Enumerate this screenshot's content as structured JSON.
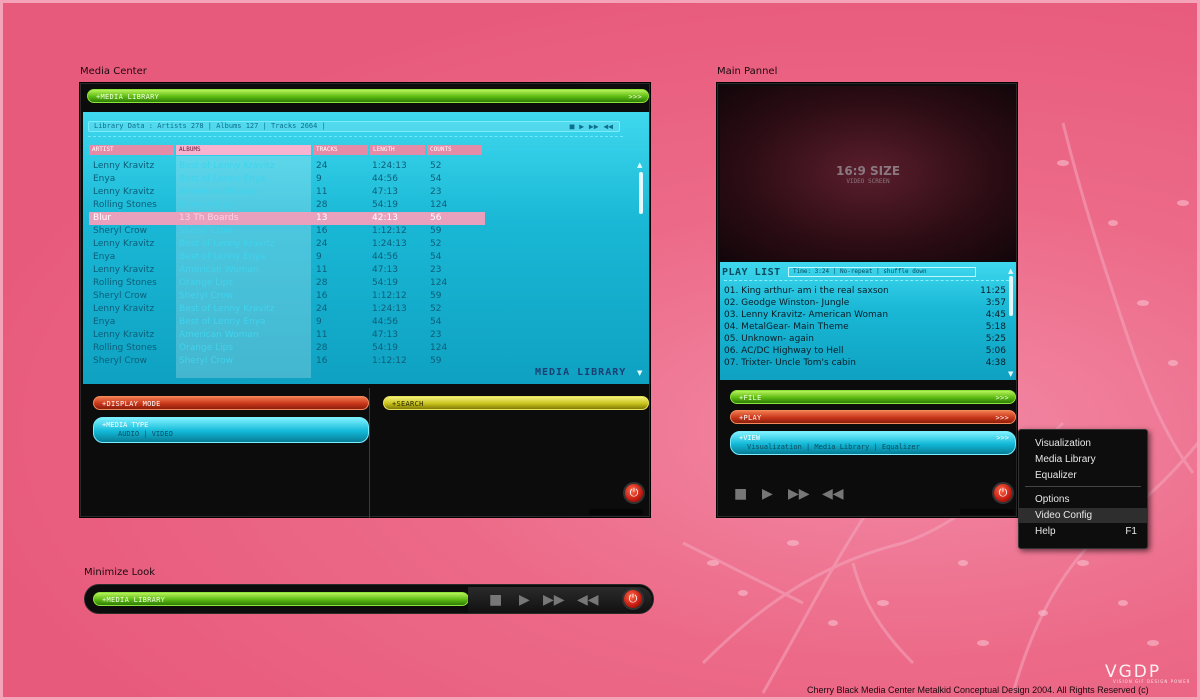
{
  "colors": {
    "background": "#e85a7c",
    "cyan": "#1ab8d6",
    "green": "#5dbb12",
    "red": "#c8361a",
    "yellow": "#c9c21b"
  },
  "media_center": {
    "title": "Media Center",
    "header_pill": "+MEDIA LIBRARY",
    "header_arrows": ">>>",
    "library_data": "Library Data :  Artists 278 | Albums 127 | Tracks 2664 |",
    "columns": [
      "ARTIST",
      "ALBUMS",
      "TRACKS",
      "LENGTH",
      "COUNTS"
    ],
    "rows": [
      [
        "Lenny Kravitz",
        "Best of Lenny Kravitz",
        "24",
        "1:24:13",
        "52"
      ],
      [
        "Enya",
        "Best of Lenny Enya",
        "9",
        "44:56",
        "54"
      ],
      [
        "Lenny Kravitz",
        "American Woman",
        "11",
        "47:13",
        "23"
      ],
      [
        "Rolling Stones",
        "Orange Lips",
        "28",
        "54:19",
        "124"
      ],
      [
        "Blur",
        "13 Th Boards",
        "13",
        "42:13",
        "56"
      ],
      [
        "Sheryl Crow",
        "Sheryl Crow",
        "16",
        "1:12:12",
        "59"
      ],
      [
        "Lenny Kravitz",
        "Best of Lenny Kravitz",
        "24",
        "1:24:13",
        "52"
      ],
      [
        "Enya",
        "Best of Lenny Enya",
        "9",
        "44:56",
        "54"
      ],
      [
        "Lenny Kravitz",
        "American Woman",
        "11",
        "47:13",
        "23"
      ],
      [
        "Rolling Stones",
        "Orange Lips",
        "28",
        "54:19",
        "124"
      ],
      [
        "Sheryl Crow",
        "Sheryl Crow",
        "16",
        "1:12:12",
        "59"
      ],
      [
        "Lenny Kravitz",
        "Best of Lenny Kravitz",
        "24",
        "1:24:13",
        "52"
      ],
      [
        "Enya",
        "Best of Lenny Enya",
        "9",
        "44:56",
        "54"
      ],
      [
        "Lenny Kravitz",
        "American Woman",
        "11",
        "47:13",
        "23"
      ],
      [
        "Rolling Stones",
        "Orange Lips",
        "28",
        "54:19",
        "124"
      ],
      [
        "Sheryl Crow",
        "Sheryl Crow",
        "16",
        "1:12:12",
        "59"
      ]
    ],
    "library_brand": "MEDIA LIBRARY",
    "display_mode": "+DISPLAY MODE",
    "media_type": "+MEDIA TYPE",
    "media_type_options": "AUDIO   |   VIDEO",
    "search": "+SEARCH",
    "search_arrows": ">>>"
  },
  "main_panel": {
    "title": "Main Pannel",
    "video_size": "16:9 SIZE",
    "video_sub": "VIDEO SCREEN",
    "playlist_title": "PLAY LIST",
    "playlist_info": "Time: 3:24 | No-repeat | shuffle down",
    "playlist": [
      [
        "01. King arthur- am i the real saxson",
        "11:25"
      ],
      [
        "02. Geodge Winston- Jungle",
        "3:57"
      ],
      [
        "03. Lenny Kravitz- American Woman",
        "4:45"
      ],
      [
        "04. MetalGear- Main Theme",
        "5:18"
      ],
      [
        "05. Unknown- again",
        "5:25"
      ],
      [
        "06. AC/DC Highway to Hell",
        "5:06"
      ],
      [
        "07. Trixter- Uncle Tom's cabin",
        "4:38"
      ]
    ],
    "file": "+FILE",
    "play": "+PLAY",
    "view": "+VIEW",
    "view_options": "Visualization | Media Library | Equalizer",
    "arrows": ">>>"
  },
  "context_menu": {
    "items": [
      "Visualization",
      "Media Library",
      "Equalizer",
      "Options",
      "Video Config",
      "Help"
    ],
    "help_shortcut": "F1"
  },
  "minimize": {
    "title": "Minimize Look",
    "pill": "+MEDIA LIBRARY"
  },
  "brand": {
    "logo": "VGDP",
    "tagline": "VISION GIF DESIGN POWER"
  },
  "footer": "Cherry Black Media Center Metalkid Conceptual Design 2004. All Rights Reserved (c)",
  "icons": [
    "stop-icon",
    "play-icon",
    "fast-forward-icon",
    "rewind-icon",
    "power-icon",
    "scroll-up-icon",
    "scroll-down-icon"
  ]
}
